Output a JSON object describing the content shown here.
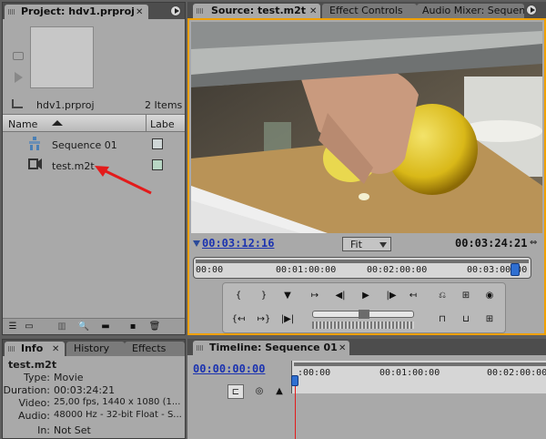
{
  "project_panel": {
    "tab_label": "Project: hdv1.prproj",
    "project_file": "hdv1.prproj",
    "item_count": "2 Items",
    "columns": [
      "Name",
      "Labe"
    ],
    "items": [
      {
        "name": "Sequence 01",
        "icon": "sequence-icon",
        "label_color": "#cfd6d6"
      },
      {
        "name": "test.m2t",
        "icon": "video-clip-icon",
        "label_color": "#b8d6c4"
      }
    ]
  },
  "annotation": {
    "arrow_color": "#e31b1b"
  },
  "source_panel": {
    "tabs": [
      "Source: test.m2t",
      "Effect Controls",
      "Audio Mixer: Sequence"
    ],
    "timecode_in": "00:03:12:16",
    "zoom_select": "Fit",
    "duration": "00:03:24:21",
    "ruler_ticks": [
      "00:00",
      "00:01:00:00",
      "00:02:00:00",
      "00:03:00:00"
    ],
    "accent_color": "#f0a000"
  },
  "info_panel": {
    "tabs": [
      "Info",
      "History",
      "Effects"
    ],
    "clip_name": "test.m2t",
    "rows": [
      {
        "label": "Type:",
        "value": "Movie"
      },
      {
        "label": "Duration:",
        "value": "00:03:24:21"
      },
      {
        "label": "Video:",
        "value": "25,00 fps, 1440 x 1080 (1..."
      },
      {
        "label": "Audio:",
        "value": "48000 Hz - 32-bit Float - S..."
      },
      {
        "label": "In:",
        "value": "Not Set"
      }
    ]
  },
  "timeline_panel": {
    "tab_label": "Timeline: Sequence 01",
    "timecode": "00:00:00:00",
    "ruler_ticks": [
      ":00:00",
      "00:01:00:00",
      "00:02:00:00"
    ]
  }
}
